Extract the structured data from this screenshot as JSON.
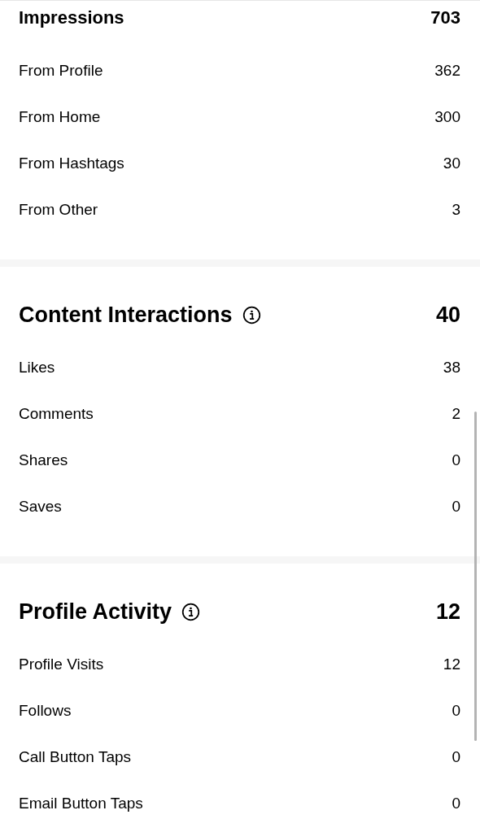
{
  "sections": [
    {
      "title": "Impressions",
      "info": false,
      "total": "703",
      "rows": [
        {
          "label": "From Profile",
          "value": "362"
        },
        {
          "label": "From Home",
          "value": "300"
        },
        {
          "label": "From Hashtags",
          "value": "30"
        },
        {
          "label": "From Other",
          "value": "3"
        }
      ]
    },
    {
      "title": "Content Interactions",
      "info": true,
      "total": "40",
      "rows": [
        {
          "label": "Likes",
          "value": "38"
        },
        {
          "label": "Comments",
          "value": "2"
        },
        {
          "label": "Shares",
          "value": "0"
        },
        {
          "label": "Saves",
          "value": "0"
        }
      ]
    },
    {
      "title": "Profile Activity",
      "info": true,
      "total": "12",
      "rows": [
        {
          "label": "Profile Visits",
          "value": "12"
        },
        {
          "label": "Follows",
          "value": "0"
        },
        {
          "label": "Call Button Taps",
          "value": "0"
        },
        {
          "label": "Email Button Taps",
          "value": "0"
        }
      ]
    }
  ]
}
